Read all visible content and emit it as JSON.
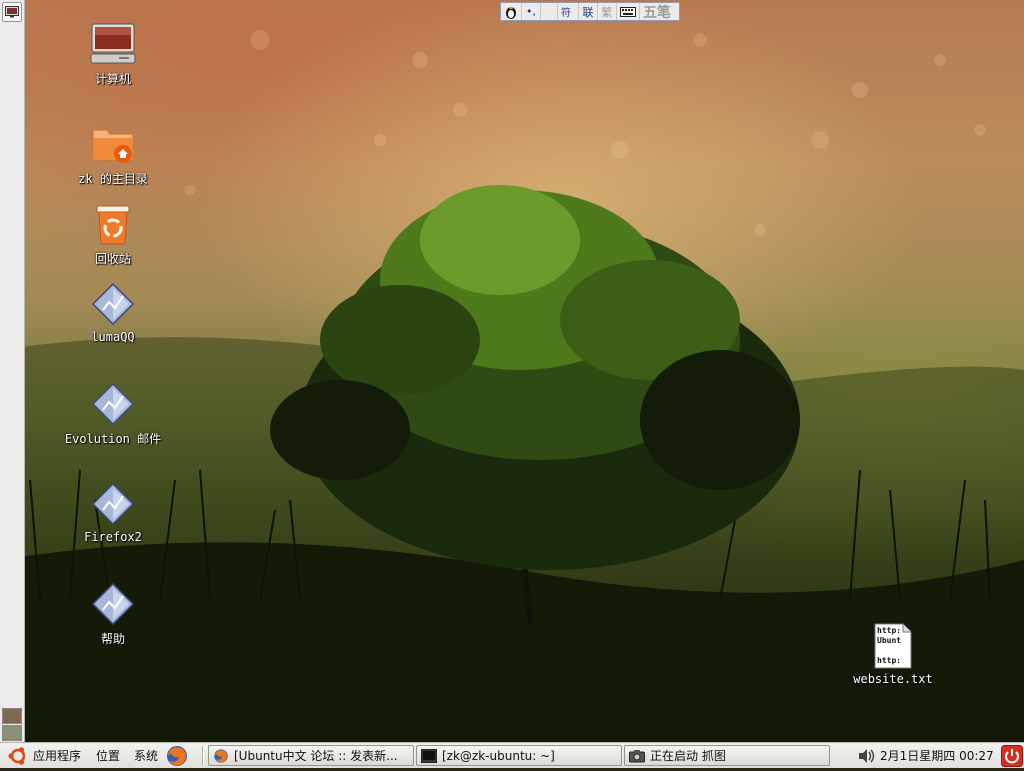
{
  "ime_bar": {
    "items": [
      "penguin-icon",
      "punctuation-icon",
      "moon-icon",
      "pinyin-icon",
      "联",
      "繁",
      "keyboard-icon"
    ],
    "mode_label": "五笔"
  },
  "desktop_icons": [
    {
      "name": "computer-icon",
      "label": "计算机"
    },
    {
      "name": "home-folder-icon",
      "label": "zk 的主目录"
    },
    {
      "name": "trash-icon",
      "label": "回收站"
    },
    {
      "name": "lumaqq-icon",
      "label": "lumaQQ"
    },
    {
      "name": "evolution-mail-icon",
      "label": "Evolution 邮件"
    },
    {
      "name": "firefox2-icon",
      "label": "Firefox2"
    },
    {
      "name": "help-icon",
      "label": "帮助"
    },
    {
      "name": "text-file-icon",
      "label": "website.txt",
      "preview_lines": [
        "http:",
        "Ubunt",
        "",
        "http:"
      ]
    }
  ],
  "panel": {
    "menus": [
      "应用程序",
      "位置",
      "系统"
    ],
    "tasks": [
      {
        "icon": "firefox-icon",
        "label": "[Ubuntu中文 论坛 :: 发表新..."
      },
      {
        "icon": "terminal-icon",
        "label": "[zk@zk-ubuntu: ~]"
      },
      {
        "icon": "camera-icon",
        "label": "正在启动 抓图"
      }
    ],
    "clock": "2月1日星期四 00:27"
  },
  "colors": {
    "panel_bg": "#e8e6e2",
    "ubuntu_orange": "#dd4814",
    "shutdown_red": "#d62f22"
  }
}
